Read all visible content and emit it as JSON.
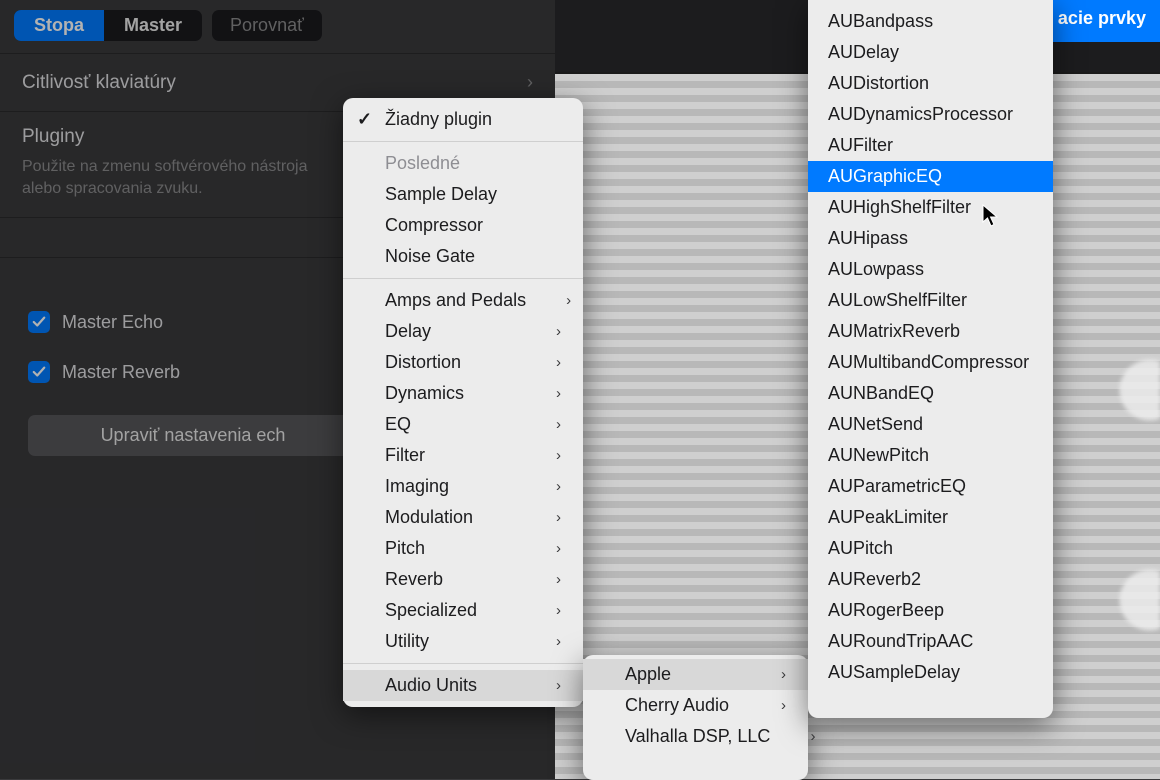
{
  "toolbar": {
    "seg_stopa": "Stopa",
    "seg_master": "Master",
    "compare": "Porovnať",
    "top_right": "acie prvky"
  },
  "panel": {
    "sensitivity": "Citlivosť klaviatúry",
    "plugins_title": "Pluginy",
    "hint": "Použite na zmenu softvérového nástroja alebo spracovania zvuku.",
    "master_echo": "Master Echo",
    "master_reverb": "Master Reverb",
    "edit_btn": "Upraviť nastavenia ech"
  },
  "menu1": {
    "none": "Žiadny plugin",
    "recent_header": "Posledné",
    "recent": [
      "Sample Delay",
      "Compressor",
      "Noise Gate"
    ],
    "cats": [
      "Amps and Pedals",
      "Delay",
      "Distortion",
      "Dynamics",
      "EQ",
      "Filter",
      "Imaging",
      "Modulation",
      "Pitch",
      "Reverb",
      "Specialized",
      "Utility"
    ],
    "audio_units": "Audio Units"
  },
  "menu2": {
    "items": [
      "Apple",
      "Cherry Audio",
      "Valhalla DSP, LLC"
    ]
  },
  "menu3": {
    "items": [
      "AUBandpass",
      "AUDelay",
      "AUDistortion",
      "AUDynamicsProcessor",
      "AUFilter",
      "AUGraphicEQ",
      "AUHighShelfFilter",
      "AUHipass",
      "AULowpass",
      "AULowShelfFilter",
      "AUMatrixReverb",
      "AUMultibandCompressor",
      "AUNBandEQ",
      "AUNetSend",
      "AUNewPitch",
      "AUParametricEQ",
      "AUPeakLimiter",
      "AUPitch",
      "AUReverb2",
      "AURogerBeep",
      "AURoundTripAAC",
      "AUSampleDelay"
    ],
    "selected_index": 5
  }
}
